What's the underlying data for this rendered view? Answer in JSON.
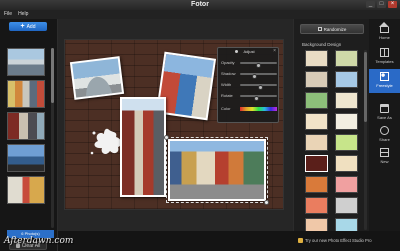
{
  "window": {
    "title": "Fotor",
    "controls": [
      "_",
      "□",
      "×"
    ]
  },
  "menu": {
    "file": "File",
    "help": "Help"
  },
  "left_panel": {
    "add_label": "Add",
    "photo_count": "6 Photo(s)",
    "clear_label": "Clear All"
  },
  "adjust": {
    "title": "Adjust",
    "close": "×",
    "rows": {
      "opacity": {
        "label": "Opacity",
        "value": 0.5
      },
      "shadow": {
        "label": "Shadow",
        "value": 0.4
      },
      "width": {
        "label": "Width",
        "value": 0.55
      },
      "rotate": {
        "label": "Rotate",
        "value": 0.45
      },
      "color": {
        "label": "Color"
      }
    }
  },
  "right_panel": {
    "random_label": "Randomize",
    "bg_title": "Background Design",
    "swatches": [
      "#e9dcc4",
      "#cfd9a8",
      "#d8cbb7",
      "#a6c9e6",
      "#8dbf7a",
      "#efe6cf",
      "#f1e3c8",
      "#f3efe2",
      "#ead4b6",
      "#c7e58a",
      "#5a1f1a",
      "#f0e0c0",
      "#d97a3a",
      "#f0a0a0",
      "#ea7d5f",
      "#cfcfcf",
      "#f0c8a8",
      "#a8d8e8",
      "#d8b0e0",
      "#f0e8d0"
    ]
  },
  "toolbar": {
    "home": "Home",
    "templates": "Templates",
    "freestyle": "Freestyle",
    "save_as": "Save As",
    "share": "Share",
    "new": "New"
  },
  "footer": {
    "watermark": "Afterdawn.com",
    "promo": "Try our new Photo Effect Studio Pro"
  }
}
